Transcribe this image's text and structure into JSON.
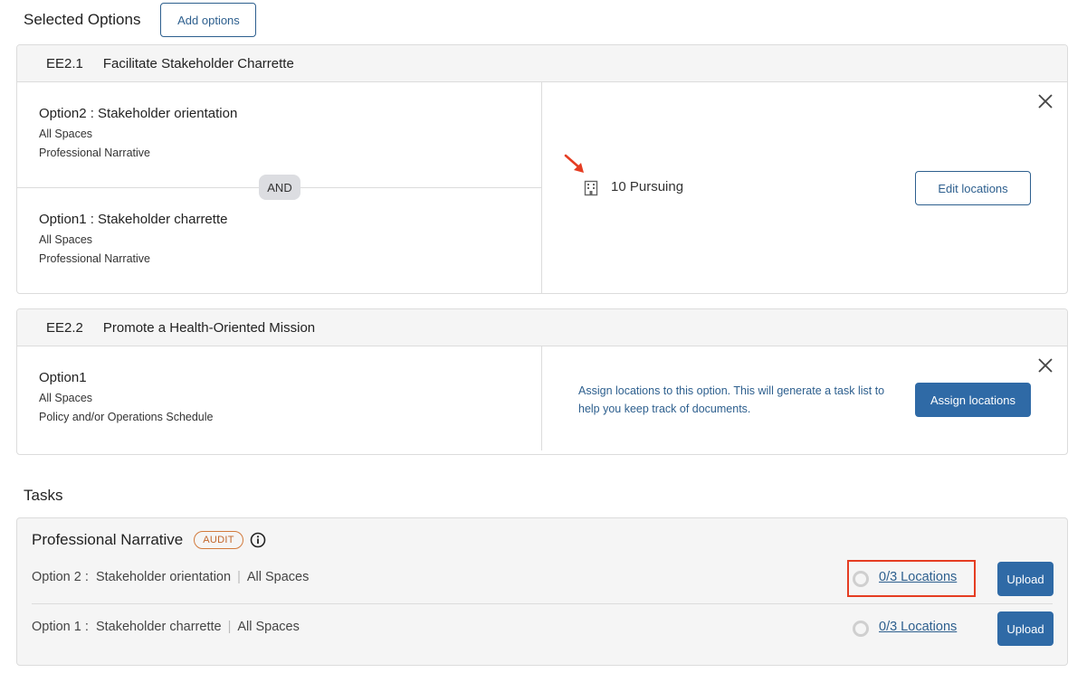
{
  "header": {
    "title": "Selected Options",
    "add_button": "Add options"
  },
  "cards": [
    {
      "code": "EE2.1",
      "title": "Facilitate Stakeholder Charrette",
      "options": [
        {
          "title": "Option2 : Stakeholder orientation",
          "scope": "All Spaces",
          "doc": "Professional Narrative"
        },
        {
          "title": "Option1 : Stakeholder charrette",
          "scope": "All Spaces",
          "doc": "Professional Narrative"
        }
      ],
      "connector": "AND",
      "status": "10 Pursuing",
      "status_icon": "building-icon",
      "action_button": "Edit locations"
    },
    {
      "code": "EE2.2",
      "title": "Promote a Health-Oriented Mission",
      "options": [
        {
          "title": "Option1",
          "scope": "All Spaces",
          "doc": "Policy and/or Operations Schedule"
        }
      ],
      "info_text": "Assign locations to this option. This will generate a task list to help you keep track of documents.",
      "action_button": "Assign locations"
    }
  ],
  "tasks": {
    "title": "Tasks",
    "group": {
      "name": "Professional Narrative",
      "badge": "AUDIT",
      "rows": [
        {
          "option": "Option 2 :",
          "name": "Stakeholder orientation",
          "scope": "All Spaces",
          "locations": "0/3 Locations",
          "upload": "Upload"
        },
        {
          "option": "Option 1 :",
          "name": "Stakeholder charrette",
          "scope": "All Spaces",
          "locations": "0/3 Locations",
          "upload": "Upload"
        }
      ]
    }
  },
  "colors": {
    "accent": "#2f6aa6",
    "annotation": "#e53d22",
    "audit": "#d27a3c"
  }
}
